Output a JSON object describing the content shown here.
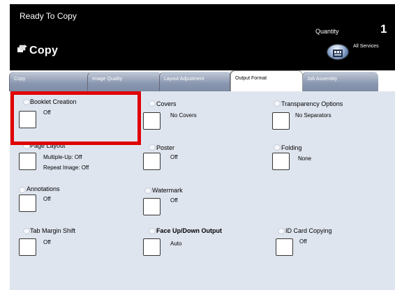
{
  "header": {
    "status": "Ready To Copy",
    "quantity_label": "Quantity",
    "quantity_value": "1",
    "title": "Copy",
    "all_services": "All Services"
  },
  "tabs": [
    {
      "label": "Copy"
    },
    {
      "label": "Image Quality"
    },
    {
      "label": "Layout Adjustment"
    },
    {
      "label": "Output Format",
      "active": true
    },
    {
      "label": "Job Assembly"
    }
  ],
  "options": {
    "booklet": {
      "label": "Booklet Creation",
      "value": "Off"
    },
    "covers": {
      "label": "Covers",
      "value": "No Covers"
    },
    "transparency": {
      "label": "Transparency Options",
      "value": "No Separators"
    },
    "page_layout": {
      "label": "Page Layout",
      "value1": "Multiple-Up: Off",
      "value2": "Repeat Image: Off"
    },
    "poster": {
      "label": "Poster",
      "value": "Off"
    },
    "folding": {
      "label": "Folding",
      "value": "None"
    },
    "annotations": {
      "label": "Annotations",
      "value": "Off"
    },
    "watermark": {
      "label": "Watermark",
      "value": "Off"
    },
    "tab_margin": {
      "label": "Tab Margin Shift",
      "value": "Off"
    },
    "face_updown": {
      "label": "Face Up/Down Output",
      "value": "Auto"
    },
    "id_card": {
      "label": "ID Card Copying",
      "value": "Off"
    }
  },
  "colors": {
    "highlight": "#e00000",
    "panel": "#dfe5ef",
    "header": "#000000"
  }
}
